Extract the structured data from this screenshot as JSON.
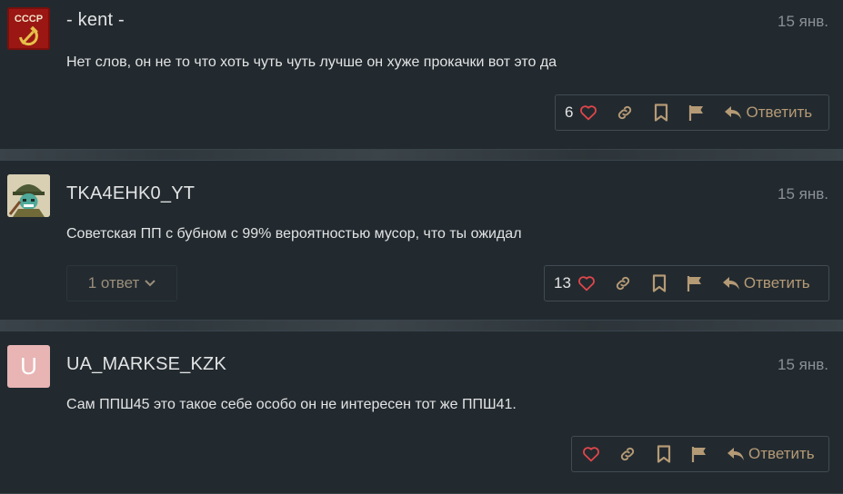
{
  "comments": [
    {
      "author": "- kent -",
      "date": "15 янв.",
      "text": "Нет слов, он не то что хоть чуть чуть лучше он хуже прокачки вот это да",
      "likes": "6",
      "avatar": {
        "type": "image",
        "caption": "СССР",
        "icon": "hammer-sickle-icon"
      }
    },
    {
      "author": "TKA4EHK0_YT",
      "date": "15 янв.",
      "text": "Советская ПП с бубном с 99% вероятностью мусор, что ты ожидал",
      "likes": "13",
      "replies_label": "1 ответ",
      "avatar": {
        "type": "image",
        "icon": "soldier-icon"
      }
    },
    {
      "author": "UA_MARKSE_KZK",
      "date": "15 янв.",
      "text": "Сам ППШ45 это такое себе особо он не интересен тот же ППШ41.",
      "likes": "",
      "avatar": {
        "type": "letter",
        "letter": "U"
      }
    }
  ],
  "actions": {
    "reply_label": "Ответить",
    "icons": [
      "heart-icon",
      "link-icon",
      "bookmark-icon",
      "flag-icon",
      "reply-icon"
    ]
  },
  "colors": {
    "background": "#222a2f",
    "accent": "#b59a76",
    "heart": "#e0464b",
    "text": "#e2e3e4",
    "muted": "#8a9095"
  }
}
